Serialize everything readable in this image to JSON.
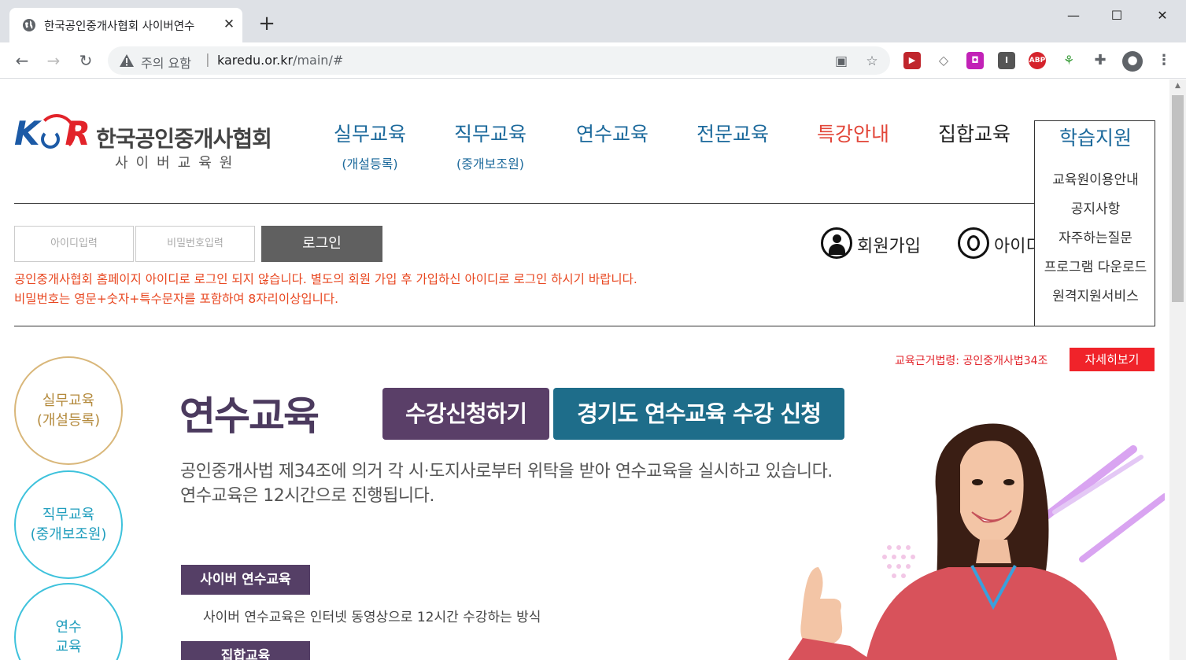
{
  "browser": {
    "tab_title": "한국공인중개사협회 사이버연수",
    "url_security": "주의 요함",
    "url_domain": "karedu.or.kr",
    "url_path": "/main/#",
    "extensions": [
      "ABP"
    ]
  },
  "header": {
    "logo_mark_k": "K",
    "logo_mark_r": "R",
    "logo_name": "한국공인중개사협회",
    "logo_sub": "사이버교육원",
    "nav": [
      {
        "label": "실무교육",
        "sub": "(개설등록)",
        "color": "#1d6a9c"
      },
      {
        "label": "직무교육",
        "sub": "(중개보조원)",
        "color": "#1d6a9c"
      },
      {
        "label": "연수교육",
        "sub": "",
        "color": "#1d6a9c"
      },
      {
        "label": "전문교육",
        "sub": "",
        "color": "#1d6a9c"
      },
      {
        "label": "특강안내",
        "sub": "",
        "color": "#e2473a"
      },
      {
        "label": "집합교육",
        "sub": "",
        "color": "#222222"
      }
    ],
    "dropdown": {
      "title": "학습지원",
      "items": [
        "교육원이용안내",
        "공지사항",
        "자주하는질문",
        "프로그램 다운로드",
        "원격지원서비스"
      ]
    }
  },
  "login": {
    "id_placeholder": "아이디입력",
    "pw_placeholder": "비밀번호입력",
    "button": "로그인",
    "note1": "공인중개사협회 홈페이지 아이디로 로그인 되지 않습니다. 별도의 회원 가입 후 가입하신 아이디로 로그인 하시기 바랍니다.",
    "note2": "비밀번호는 영문+숫자+특수문자를 포함하여 8자리이상입니다.",
    "signup": "회원가입",
    "find_id": "아이디"
  },
  "law": {
    "text": "교육근거법령: 공인중개사법34조",
    "button": "자세히보기"
  },
  "side_menu": [
    {
      "label": "실무교육\n(개설등록)",
      "color": "#c9a45a"
    },
    {
      "label": "직무교육\n(중개보조원)",
      "color": "#29b3d4"
    },
    {
      "label": "연수\n교육",
      "color": "#29b3d4"
    }
  ],
  "main": {
    "title": "연수교육",
    "cta1": "수강신청하기",
    "cta2": "경기도 연수교육 수강 신청",
    "desc1": "공인중개사법 제34조에 의거 각 시·도지사로부터 위탁을 받아 연수교육을 실시하고 있습니다.",
    "desc2": "연수교육은 12시간으로 진행됩니다.",
    "label1": "사이버 연수교육",
    "label1_desc": "사이버 연수교육은 인터넷 동영상으로 12시간 수강하는 방식",
    "label2": "집합교육"
  }
}
